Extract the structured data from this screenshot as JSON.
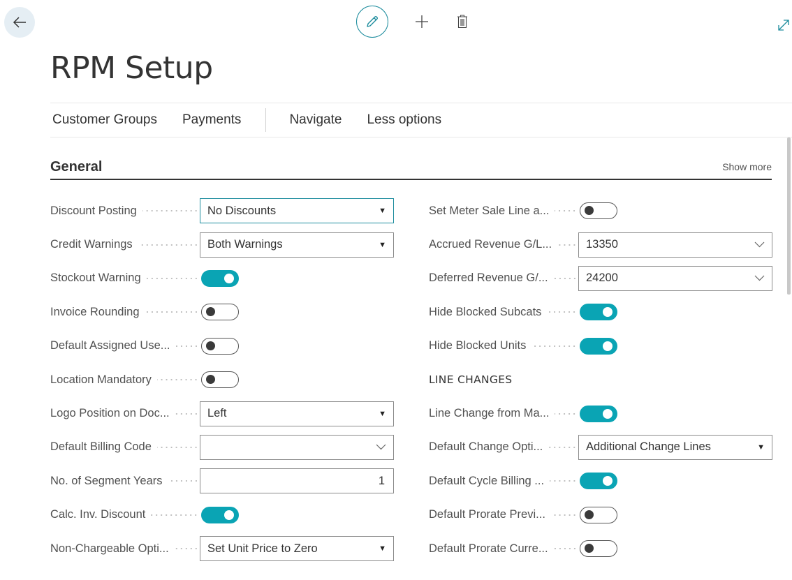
{
  "page": {
    "title": "RPM Setup",
    "icons": {
      "back": "arrow-left-icon",
      "edit": "pencil-icon",
      "new": "plus-icon",
      "delete": "trash-icon",
      "expand": "expand-icon"
    }
  },
  "action_bar": {
    "items": [
      "Customer Groups",
      "Payments",
      "Navigate",
      "Less options"
    ]
  },
  "section": {
    "title": "General",
    "show_more": "Show more"
  },
  "left_fields": [
    {
      "label": "Discount Posting",
      "type": "select",
      "value": "No Discounts",
      "focused": true
    },
    {
      "label": "Credit Warnings",
      "type": "select",
      "value": "Both Warnings"
    },
    {
      "label": "Stockout Warning",
      "type": "toggle",
      "on": true
    },
    {
      "label": "Invoice Rounding",
      "type": "toggle",
      "on": false
    },
    {
      "label": "Default Assigned Use...",
      "type": "toggle",
      "on": false
    },
    {
      "label": "Location Mandatory",
      "type": "toggle",
      "on": false
    },
    {
      "label": "Logo Position on Doc...",
      "type": "select",
      "value": "Left"
    },
    {
      "label": "Default Billing Code",
      "type": "lookup",
      "value": ""
    },
    {
      "label": "No. of Segment Years",
      "type": "input",
      "value": "1"
    },
    {
      "label": "Calc. Inv. Discount",
      "type": "toggle",
      "on": true
    },
    {
      "label": "Non-Chargeable Opti...",
      "type": "select",
      "value": "Set Unit Price to Zero"
    }
  ],
  "right_fields": [
    {
      "label": "Set Meter Sale Line a...",
      "type": "toggle",
      "on": false
    },
    {
      "label": "Accrued Revenue G/L...",
      "type": "lookup",
      "value": "13350"
    },
    {
      "label": "Deferred Revenue G/...",
      "type": "lookup",
      "value": "24200"
    },
    {
      "label": "Hide Blocked Subcats",
      "type": "toggle",
      "on": true
    },
    {
      "label": "Hide Blocked Units",
      "type": "toggle",
      "on": true
    },
    {
      "label": "LINE CHANGES",
      "type": "group"
    },
    {
      "label": "Line Change from Ma...",
      "type": "toggle",
      "on": true
    },
    {
      "label": "Default Change Opti...",
      "type": "select",
      "value": "Additional Change Lines"
    },
    {
      "label": "Default Cycle Billing ...",
      "type": "toggle",
      "on": true
    },
    {
      "label": "Default Prorate Previ...",
      "type": "toggle",
      "on": false
    },
    {
      "label": "Default Prorate Curre...",
      "type": "toggle",
      "on": false
    }
  ],
  "colors": {
    "accent": "#0aa4b4",
    "focus": "#1c8c9d",
    "text": "#505050"
  }
}
